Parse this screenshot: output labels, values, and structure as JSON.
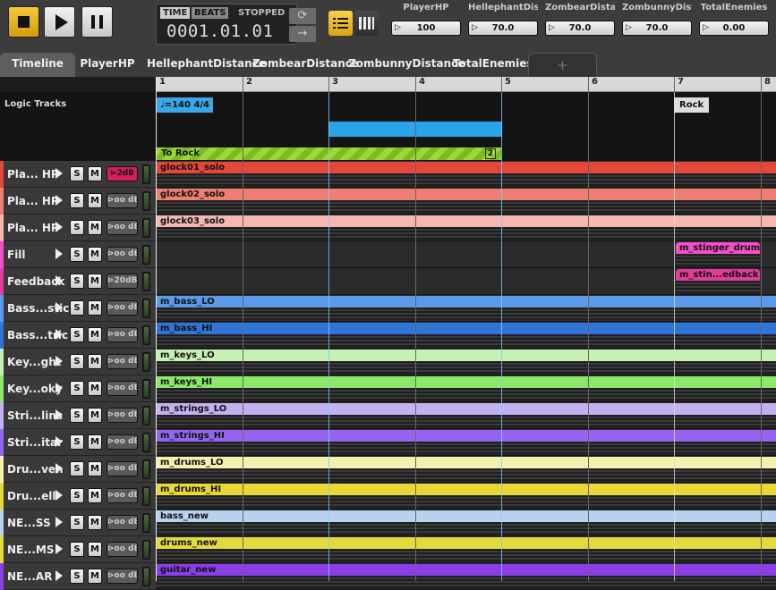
{
  "toolbar": {
    "transport": {
      "time_label": "TIME",
      "beats_label": "BEATS",
      "status": "STOPPED",
      "position": "0001.01.01"
    },
    "params": [
      {
        "name": "PlayerHP",
        "value": "100"
      },
      {
        "name": "HellephantDis...",
        "value": "70.0"
      },
      {
        "name": "ZombearDista...",
        "value": "70.0"
      },
      {
        "name": "ZombunnyDist...",
        "value": "70.0"
      },
      {
        "name": "TotalEnemies",
        "value": "0.00"
      }
    ]
  },
  "tabs": [
    "Timeline",
    "PlayerHP",
    "HellephantDistance",
    "ZombearDistance",
    "ZombunnyDistance",
    "TotalEnemies"
  ],
  "tab_add": "+",
  "ruler": [
    "1",
    "2",
    "3",
    "4",
    "5",
    "6",
    "7",
    "8"
  ],
  "logic": {
    "label": "Logic Tracks",
    "tempo": "♩=140 4/4",
    "marker": "Rock",
    "transition": "To Rock",
    "transition_count": "2"
  },
  "tracks": [
    {
      "name": "Pla... HP",
      "vol": "⊳2dB",
      "color": "#e5473a",
      "clip": "glock01_solo",
      "hot": true
    },
    {
      "name": "Pla... HP",
      "vol": "⊳oo dB",
      "color": "#ef7f70",
      "clip": "glock02_solo"
    },
    {
      "name": "Pla... HP",
      "vol": "⊳oo dB",
      "color": "#f4b8b0",
      "clip": "glock03_solo"
    },
    {
      "name": "Fill",
      "vol": "⊳oo dB",
      "color": "#f24fc8",
      "clip": "m_stinger_drums"
    },
    {
      "name": "Feedback",
      "vol": "⊳20dB",
      "color": "#e33c9a",
      "clip": "m_stin...edback"
    },
    {
      "name": "Bass...stic",
      "vol": "⊳oo dB",
      "color": "#5a9ae8",
      "clip": "m_bass_LO"
    },
    {
      "name": "Bass...tric",
      "vol": "⊳oo dB",
      "color": "#2f74d6",
      "clip": "m_bass_HI"
    },
    {
      "name": "Key...ght",
      "vol": "⊳oo dB",
      "color": "#c7f0b4",
      "clip": "m_keys_LO"
    },
    {
      "name": "Key...oky",
      "vol": "⊳oo dB",
      "color": "#8ce86a",
      "clip": "m_keys_HI"
    },
    {
      "name": "Stri...lins",
      "vol": "⊳oo dB",
      "color": "#c3b2f2",
      "clip": "m_strings_LO"
    },
    {
      "name": "Stri...itar",
      "vol": "⊳oo dB",
      "color": "#9466f0",
      "clip": "m_strings_HI"
    },
    {
      "name": "Dru...ven",
      "vol": "⊳oo dB",
      "color": "#f3f0b0",
      "clip": "m_drums_LO"
    },
    {
      "name": "Dru...ell",
      "vol": "⊳oo dB",
      "color": "#e8d735",
      "clip": "m_drums_HI"
    },
    {
      "name": "NE...SS",
      "vol": "⊳oo dB",
      "color": "#b8d2ee",
      "clip": "bass_new"
    },
    {
      "name": "NE...MS",
      "vol": "⊳oo dB",
      "color": "#e4da3c",
      "clip": "drums_new"
    },
    {
      "name": "NE...AR",
      "vol": "⊳oo dB",
      "color": "#8a3ee8",
      "clip": "guitar_new"
    }
  ],
  "track_buttons": {
    "solo": "S",
    "mute": "M"
  }
}
